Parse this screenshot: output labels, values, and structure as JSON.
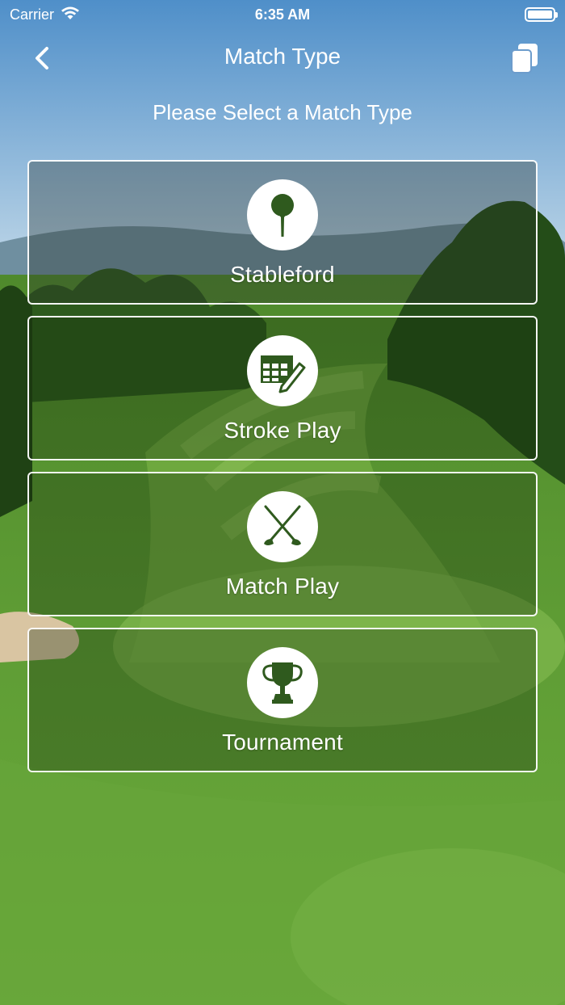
{
  "status_bar": {
    "carrier": "Carrier",
    "time": "6:35 AM",
    "icons": [
      "wifi-icon",
      "battery-icon"
    ]
  },
  "nav": {
    "title": "Match Type",
    "back_icon": "chevron-left-icon",
    "right_icon": "copy-icon"
  },
  "subtitle": "Please Select a Match Type",
  "match_types": [
    {
      "label": "Stableford",
      "icon": "golf-tee-icon"
    },
    {
      "label": "Stroke Play",
      "icon": "scorecard-icon"
    },
    {
      "label": "Match Play",
      "icon": "crossed-clubs-icon"
    },
    {
      "label": "Tournament",
      "icon": "trophy-icon"
    }
  ],
  "colors": {
    "icon_color": "#2f5a1e",
    "card_border": "#ffffff",
    "text": "#ffffff"
  }
}
